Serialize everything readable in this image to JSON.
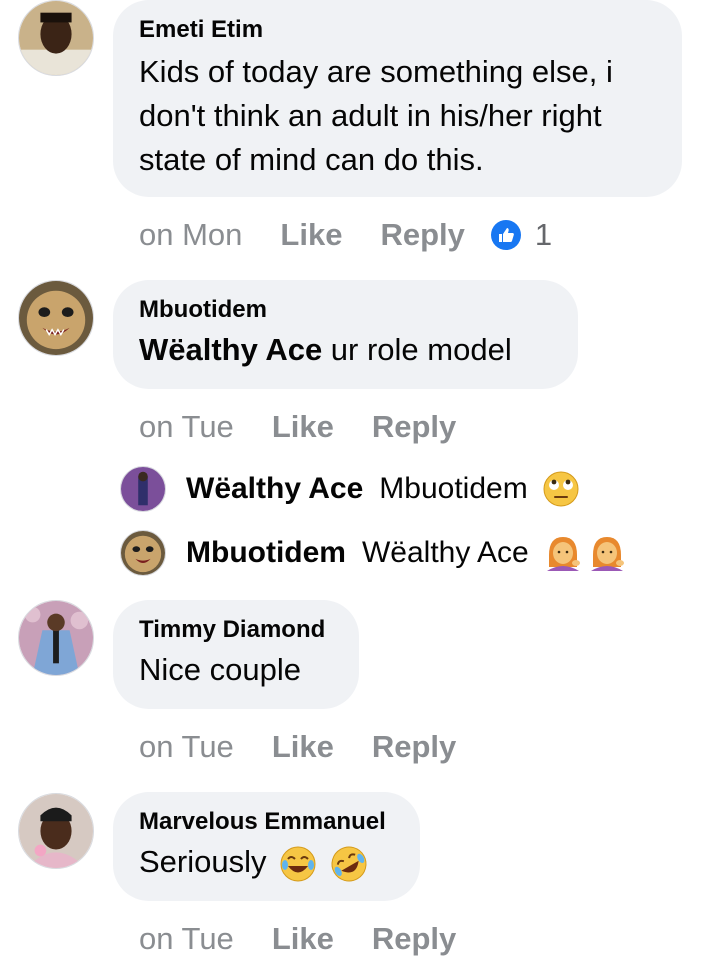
{
  "comments": [
    {
      "author": "Emeti Etim",
      "lines": [
        "Kids of today are something else, i",
        "don't think an adult in his/her right",
        "state of mind can do this."
      ],
      "time": "on Mon",
      "like": "Like",
      "reply": "Reply",
      "reactions": "1"
    },
    {
      "author": "Mbuotidem",
      "tag": "Wëalthy Ace",
      "text": " ur role model",
      "time": "on Tue",
      "like": "Like",
      "reply": "Reply",
      "replies": [
        {
          "name": "Wëalthy Ace",
          "text": "Mbuotidem",
          "emoji": "face-with-rolling-eyes"
        },
        {
          "name": "Mbuotidem",
          "text": "Wëalthy Ace",
          "emoji": "woman-tipping-hand x2"
        }
      ]
    },
    {
      "author": "Timmy Diamond",
      "text": "Nice couple",
      "time": "on Tue",
      "like": "Like",
      "reply": "Reply"
    },
    {
      "author": "Marvelous Emmanuel",
      "text": "Seriously",
      "emoji": "rolling-on-floor-laughing x2",
      "time": "on Tue",
      "like": "Like",
      "reply": "Reply"
    }
  ],
  "colors": {
    "bubble": "#f0f2f5",
    "meta": "#8a8d91",
    "like_blue": "#1877f2",
    "text": "#050505"
  }
}
